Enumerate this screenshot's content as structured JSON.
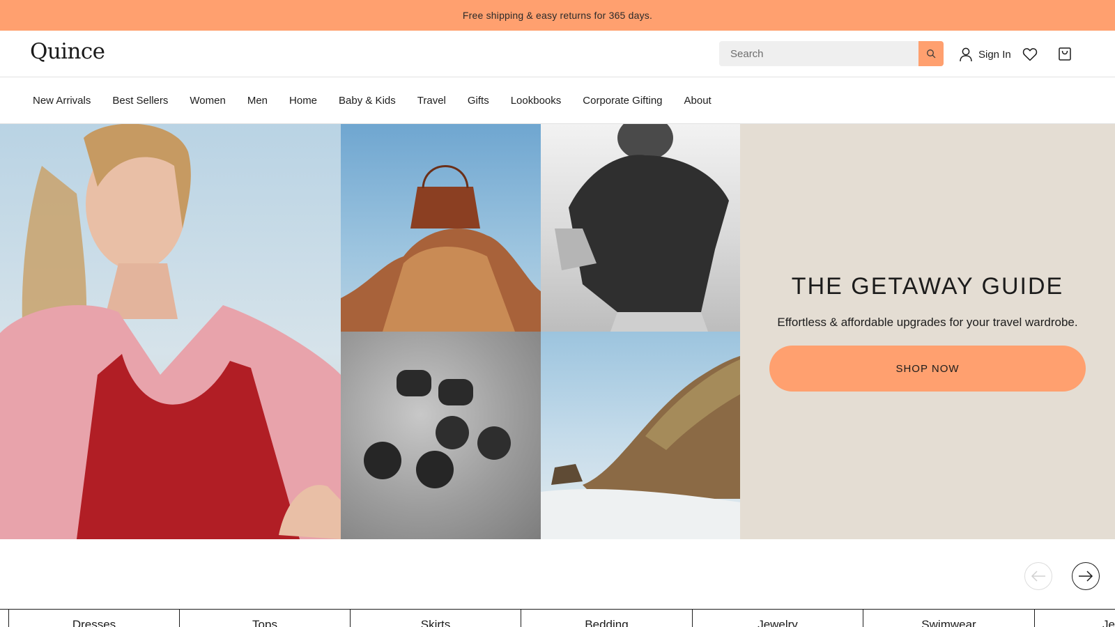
{
  "promo": {
    "text": "Free shipping & easy returns for 365 days."
  },
  "header": {
    "logo": "Quince",
    "search": {
      "placeholder": "Search",
      "value": ""
    },
    "sign_in": "Sign In",
    "icons": [
      "search-icon",
      "user-icon",
      "heart-icon",
      "bag-icon"
    ]
  },
  "nav": {
    "items": [
      {
        "label": "New Arrivals"
      },
      {
        "label": "Best Sellers"
      },
      {
        "label": "Women"
      },
      {
        "label": "Men"
      },
      {
        "label": "Home"
      },
      {
        "label": "Baby & Kids"
      },
      {
        "label": "Travel"
      },
      {
        "label": "Gifts"
      },
      {
        "label": "Lookbooks"
      },
      {
        "label": "Corporate Gifting"
      },
      {
        "label": "About"
      }
    ]
  },
  "hero": {
    "title": "THE GETAWAY GUIDE",
    "subtitle": "Effortless & affordable upgrades for your travel wardrobe.",
    "cta": "SHOP NOW",
    "images": [
      "woman-in-red-swimsuit",
      "leather-tote-on-rock",
      "linen-shirt",
      "sunglasses-on-rock",
      "coastal-cliff"
    ]
  },
  "carousel": {
    "prev_icon": "arrow-left-icon",
    "next_icon": "arrow-right-icon"
  },
  "categories": {
    "items": [
      {
        "label": "Dresses"
      },
      {
        "label": "Tops"
      },
      {
        "label": "Skirts"
      },
      {
        "label": "Bedding"
      },
      {
        "label": "Jewelry"
      },
      {
        "label": "Swimwear"
      },
      {
        "label": "Je"
      }
    ]
  },
  "colors": {
    "accent": "#ffa06f",
    "panel": "#e4ddd3",
    "text": "#1c1c1c"
  }
}
